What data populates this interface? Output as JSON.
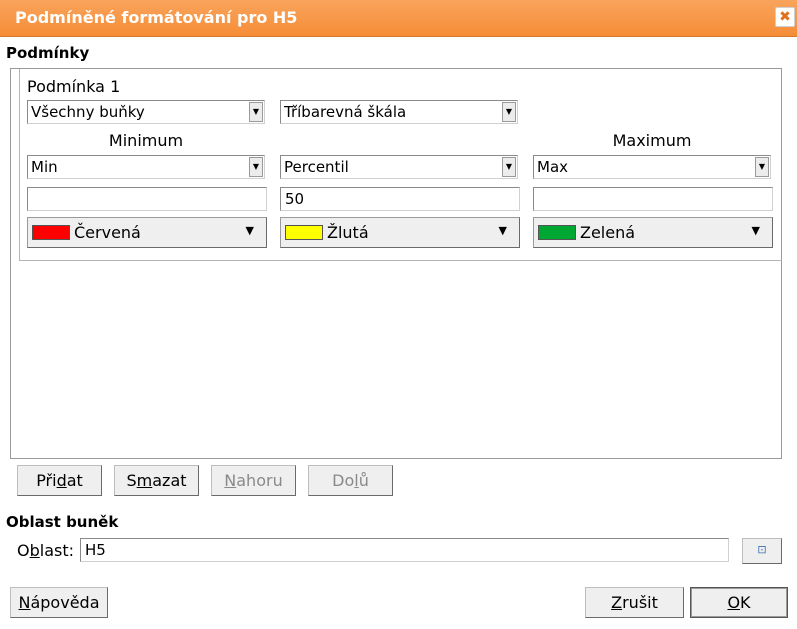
{
  "dialog": {
    "title": "Podmíněné formátování pro H5",
    "close_glyph": "✖"
  },
  "conditions": {
    "section_title": "Podmínky",
    "condition": {
      "name": "Podmínka 1",
      "apply_to": "Všechny buňky",
      "style": "Tříbarevná škála",
      "minimum": {
        "label": "Minimum",
        "type": "Min",
        "value": "",
        "color_name": "Červená",
        "color": "#ff0000"
      },
      "middle": {
        "label": "",
        "type": "Percentil",
        "value": "50",
        "color_name": "Žlutá",
        "color": "#ffff00"
      },
      "maximum": {
        "label": "Maximum",
        "type": "Max",
        "value": "",
        "color_name": "Zelená",
        "color": "#00a833"
      }
    },
    "buttons": {
      "add_pre": "Při",
      "add_key": "d",
      "add_post": "at",
      "delete_pre": "S",
      "delete_key": "m",
      "delete_post": "azat",
      "up_pre": "",
      "up_key": "N",
      "up_post": "ahoru",
      "down_pre": "Do",
      "down_key": "l",
      "down_post": "ů"
    }
  },
  "cell_range": {
    "section_title": "Oblast buněk",
    "label_pre": "O",
    "label_key": "b",
    "label_post": "last:",
    "value": "H5"
  },
  "footer": {
    "help_pre": "",
    "help_key": "N",
    "help_post": "ápověda",
    "cancel_pre": "",
    "cancel_key": "Z",
    "cancel_post": "rušit",
    "ok_pre": "",
    "ok_key": "O",
    "ok_post": "K"
  },
  "colors": {
    "titlebar": "#f58d37"
  }
}
